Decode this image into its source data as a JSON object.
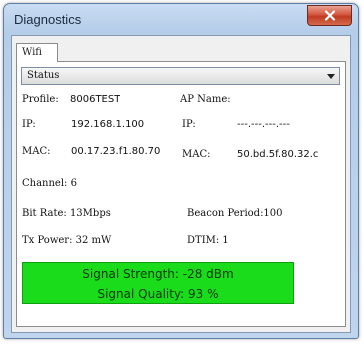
{
  "window": {
    "title": "Diagnostics",
    "close_icon": "close-icon"
  },
  "tabs": [
    {
      "label": "Wifi",
      "selected": true
    }
  ],
  "status_select": {
    "value": "Status"
  },
  "fields": {
    "profile_label": "Profile:",
    "profile_value": "8006TEST",
    "ap_name_label": "AP Name:",
    "ap_name_value": "",
    "ip_label": "IP:",
    "ip_value": "192.168.1.100",
    "ap_ip_label": "IP:",
    "ap_ip_value": "---.---.---.---",
    "mac_label": "MAC:",
    "mac_value": "00.17.23.f1.80.70",
    "ap_mac_label": "MAC:",
    "ap_mac_value": "50.bd.5f.80.32.c",
    "channel": "Channel: 6",
    "bit_rate": "Bit Rate: 13Mbps",
    "beacon_period": "Beacon Period:100",
    "tx_power": "Tx Power:  32 mW",
    "dtim": "DTIM:  1"
  },
  "signal": {
    "strength": "Signal Strength: -28 dBm",
    "quality": "Signal Quality:  93 %",
    "color": "#1bdc1b"
  }
}
